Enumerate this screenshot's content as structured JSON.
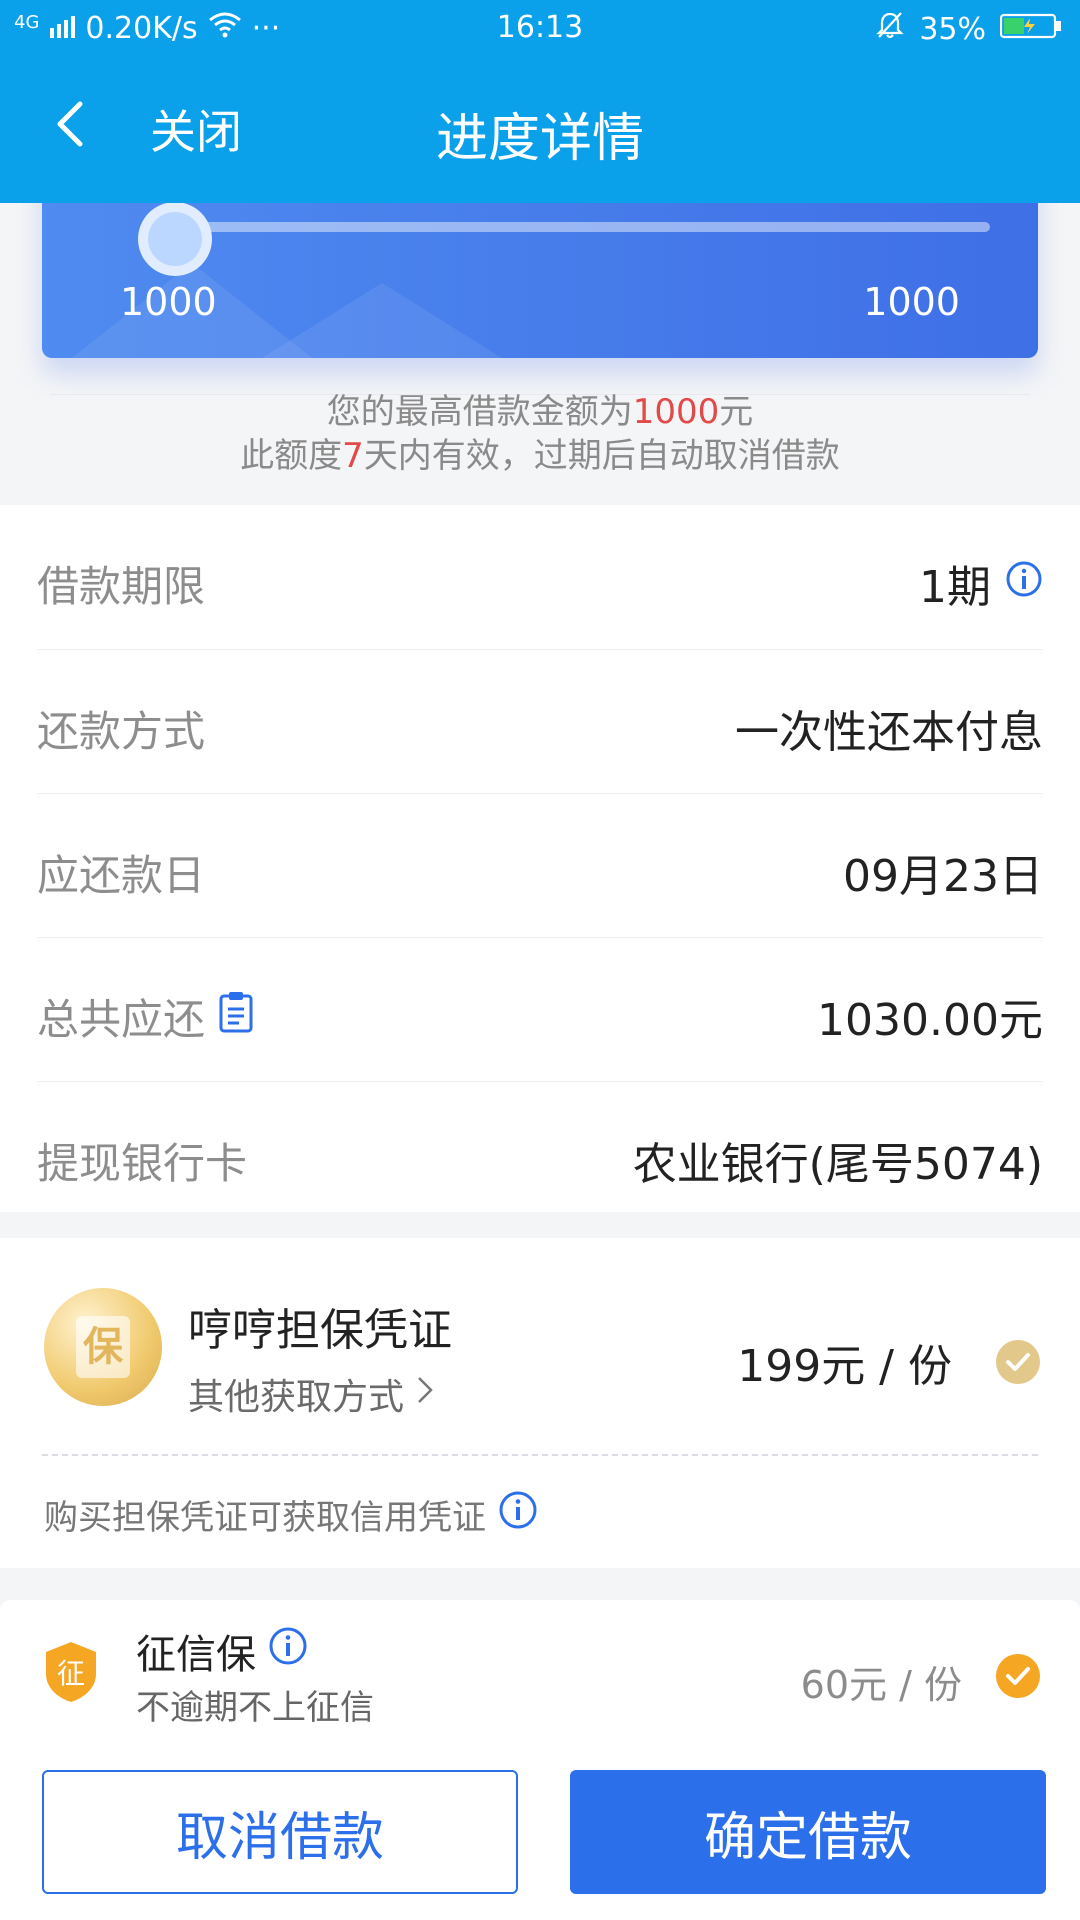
{
  "status_bar": {
    "network": "4G",
    "speed": "0.20K/s",
    "more": "···",
    "time": "16:13",
    "battery": "35%"
  },
  "nav": {
    "back_icon": "chevron-left-icon",
    "close_label": "关闭",
    "title": "进度详情"
  },
  "slider": {
    "min_label": "1000",
    "max_label": "1000",
    "level": 0
  },
  "note": {
    "line1_prefix": "您的最高借款金额为",
    "line1_amount": "1000",
    "line1_suffix": "元",
    "line2_prefix": "此额度",
    "line2_days": "7",
    "line2_suffix": "天内有效，过期后自动取消借款"
  },
  "rows": [
    {
      "label": "借款期限",
      "value": "1期",
      "icon": "info-icon"
    },
    {
      "label": "还款方式",
      "value": "一次性还本付息"
    },
    {
      "label": "应还款日",
      "value": "09月23日"
    },
    {
      "label": "总共应还",
      "value": "1030.00元",
      "label_icon": "clipboard-icon"
    },
    {
      "label": "提现银行卡",
      "value": "农业银行(尾号5074)"
    }
  ],
  "guarantee": {
    "badge_text": "保",
    "title": "哼哼担保凭证",
    "subtitle": "其他获取方式",
    "price": "199元 / 份",
    "note": "购买担保凭证可获取信用凭证"
  },
  "credit": {
    "badge_text": "征",
    "title": "征信保",
    "subtitle": "不逾期不上征信",
    "price": "60元 / 份"
  },
  "buttons": {
    "cancel": "取消借款",
    "confirm": "确定借款"
  },
  "colors": {
    "header": "#0aa0ea",
    "primary": "#2c6fea",
    "red": "#e24a4a",
    "orange": "#f5a623"
  }
}
